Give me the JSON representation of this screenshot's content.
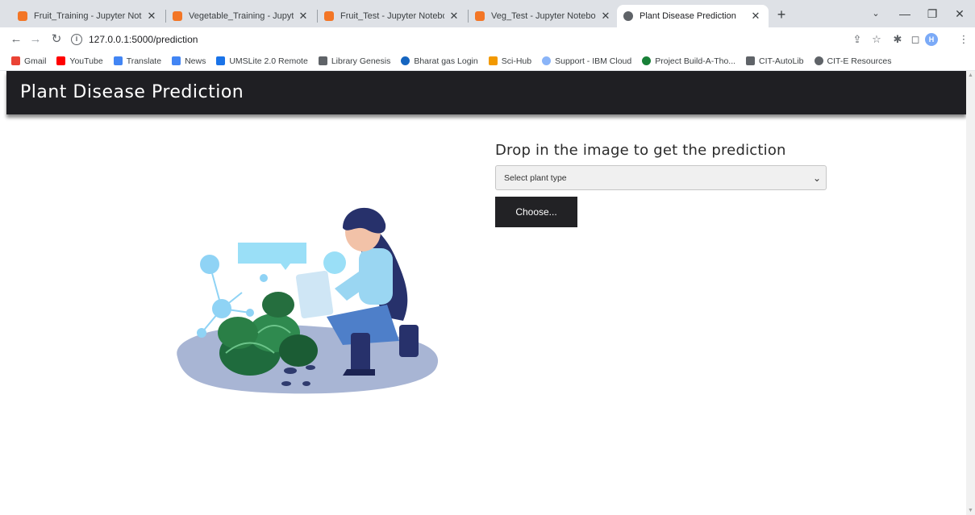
{
  "browser": {
    "tabs": [
      {
        "title": "Fruit_Training - Jupyter Notebook",
        "icon": "jupyter-icon"
      },
      {
        "title": "Vegetable_Training - Jupyter Notebook",
        "icon": "jupyter-icon"
      },
      {
        "title": "Fruit_Test - Jupyter Notebook",
        "icon": "jupyter-icon"
      },
      {
        "title": "Veg_Test - Jupyter Notebook",
        "icon": "jupyter-icon"
      },
      {
        "title": "Plant Disease Prediction",
        "icon": "globe-icon",
        "active": true
      }
    ],
    "new_tab": "+",
    "url": "127.0.0.1:5000/prediction",
    "profile_initial": "H",
    "bookmarks": [
      {
        "label": "Gmail",
        "icon": "gmail-icon",
        "color": "#ea4335"
      },
      {
        "label": "YouTube",
        "icon": "youtube-icon",
        "color": "#ff0000"
      },
      {
        "label": "Translate",
        "icon": "translate-icon",
        "color": "#4285f4"
      },
      {
        "label": "News",
        "icon": "news-icon",
        "color": "#4285f4"
      },
      {
        "label": "UMSLite 2.0 Remote",
        "icon": "ums-icon",
        "color": "#1a73e8"
      },
      {
        "label": "Library Genesis",
        "icon": "library-icon",
        "color": "#5f6368"
      },
      {
        "label": "Bharat gas Login",
        "icon": "bharatgas-icon",
        "color": "#1565c0"
      },
      {
        "label": "Sci-Hub",
        "icon": "scihub-icon",
        "color": "#f29900"
      },
      {
        "label": "Support - IBM Cloud",
        "icon": "cloud-icon",
        "color": "#8ab4f8"
      },
      {
        "label": "Project Build-A-Tho...",
        "icon": "project-icon",
        "color": "#188038"
      },
      {
        "label": "CIT-AutoLib",
        "icon": "autolib-icon",
        "color": "#5f6368"
      },
      {
        "label": "CIT-E Resources",
        "icon": "globe-icon",
        "color": "#5f6368"
      }
    ]
  },
  "page": {
    "title": "Plant Disease Prediction",
    "heading": "Drop in the image to get the prediction",
    "select_placeholder": "Select plant type",
    "choose_label": "Choose...",
    "header_bg": "#1f1f23",
    "button_bg": "#222225"
  }
}
